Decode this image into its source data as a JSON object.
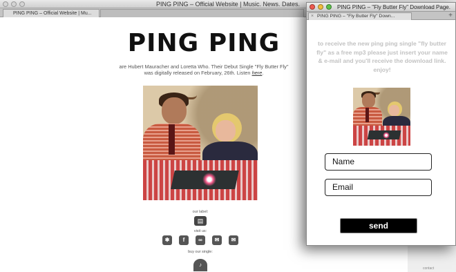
{
  "back_window": {
    "window_title": "PING PING – Official Website | Music. News. Dates.",
    "tab_label": "PING PING – Official Website | Mu...",
    "page": {
      "title": "PING PING",
      "intro_text": "are Hubert Mauracher and Loretta Who. Their Debut Single \"Fly Butter Fly\" was digitally released on February, 26th. Listen",
      "intro_link": "here",
      "intro_end": ".",
      "our_label": "our label:",
      "visit_us": "visit us:",
      "buy_single": "buy our single:",
      "footer_note": "contact"
    }
  },
  "popup_window": {
    "window_title": "PING PING – \"Fly Butter Fly\" Download Page.",
    "tab_label": "PING PING – \"Fly Butter Fly\" Down...",
    "message": "to receive the new ping ping single \"fly butter fly\" as a free mp3 please just insert your name & e-mail and you'll receive the download link. enjoy!",
    "name_field": "Name",
    "email_field": "Email",
    "send_button": "send"
  },
  "icons": {
    "social": [
      "myspace-icon",
      "facebook-icon",
      "lastfm-icon",
      "twitter-icon",
      "email-icon"
    ]
  },
  "colors": {
    "popup_text": "#c2c2c2",
    "send_bg": "#000000"
  }
}
